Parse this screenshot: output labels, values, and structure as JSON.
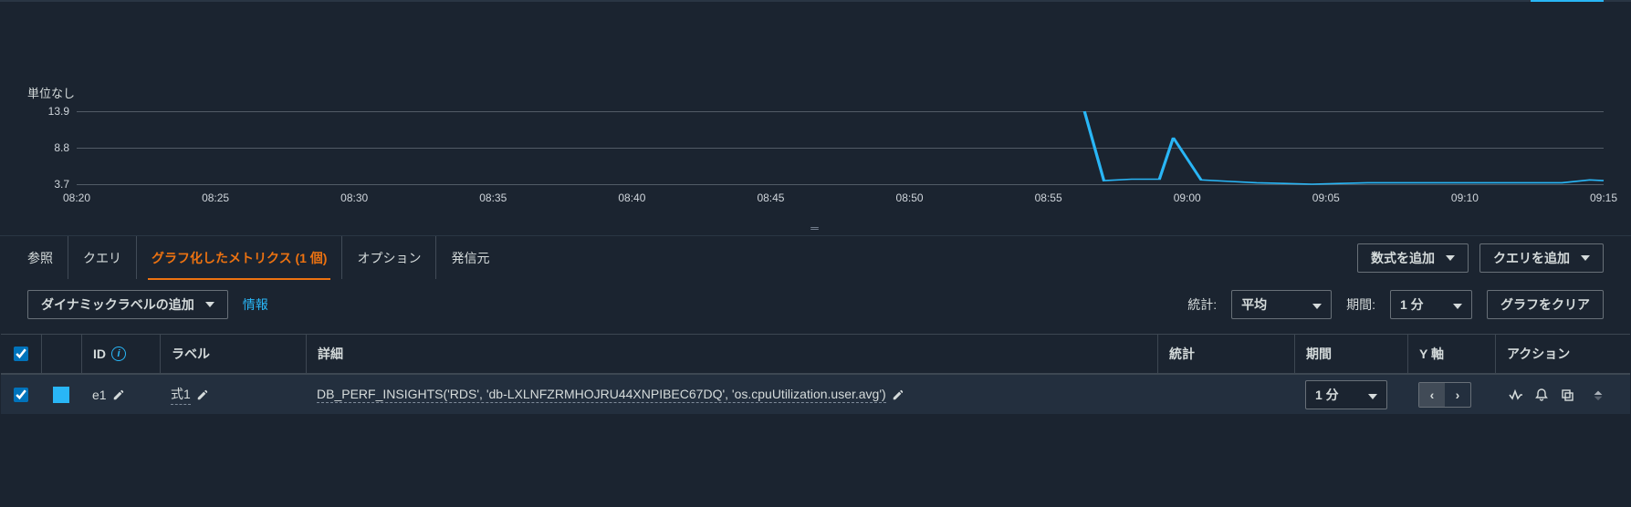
{
  "chart": {
    "unit_label": "単位なし",
    "y_ticks": [
      "13.9",
      "8.8",
      "3.7"
    ],
    "x_ticks": [
      "08:20",
      "08:25",
      "08:30",
      "08:35",
      "08:40",
      "08:45",
      "08:50",
      "08:55",
      "09:00",
      "09:05",
      "09:10",
      "09:15"
    ]
  },
  "chart_data": {
    "type": "line",
    "title": "",
    "xlabel": "",
    "ylabel": "単位なし",
    "ylim": [
      3.7,
      13.9
    ],
    "x": [
      "08:20",
      "08:25",
      "08:30",
      "08:35",
      "08:40",
      "08:45",
      "08:50",
      "08:55",
      "09:00",
      "09:05",
      "09:10",
      "09:15"
    ],
    "series": [
      {
        "name": "式1",
        "color": "#29b6f6",
        "points": [
          {
            "x": "08:56.3",
            "y": 13.9
          },
          {
            "x": "08:57.0",
            "y": 4.2
          },
          {
            "x": "08:58.0",
            "y": 4.4
          },
          {
            "x": "08:59.0",
            "y": 4.4
          },
          {
            "x": "08:59.5",
            "y": 10.2
          },
          {
            "x": "09:00.5",
            "y": 4.3
          },
          {
            "x": "09:01.5",
            "y": 4.1
          },
          {
            "x": "09:02.5",
            "y": 3.9
          },
          {
            "x": "09:03.5",
            "y": 3.8
          },
          {
            "x": "09:04.5",
            "y": 3.7
          },
          {
            "x": "09:05.5",
            "y": 3.8
          },
          {
            "x": "09:06.5",
            "y": 3.9
          },
          {
            "x": "09:07.5",
            "y": 3.9
          },
          {
            "x": "09:08.5",
            "y": 3.9
          },
          {
            "x": "09:09.5",
            "y": 3.9
          },
          {
            "x": "09:10.5",
            "y": 3.9
          },
          {
            "x": "09:11.5",
            "y": 3.9
          },
          {
            "x": "09:12.5",
            "y": 3.9
          },
          {
            "x": "09:13.5",
            "y": 3.9
          },
          {
            "x": "09:14.5",
            "y": 4.3
          },
          {
            "x": "09:15.0",
            "y": 4.2
          }
        ]
      }
    ]
  },
  "tabs": {
    "browse": "参照",
    "query": "クエリ",
    "graphed": "グラフ化したメトリクス (1 個)",
    "options": "オプション",
    "source": "発信元"
  },
  "buttons": {
    "add_math": "数式を追加",
    "add_query": "クエリを追加",
    "add_dynamic_label": "ダイナミックラベルの追加",
    "info": "情報",
    "clear_graph": "グラフをクリア"
  },
  "controls": {
    "stat_label": "統計:",
    "stat_value": "平均",
    "period_label": "期間:",
    "period_value": "1 分"
  },
  "table": {
    "headers": {
      "id": "ID",
      "label": "ラベル",
      "detail": "詳細",
      "stat": "統計",
      "period": "期間",
      "yaxis": "Y 軸",
      "action": "アクション"
    },
    "row": {
      "checked": true,
      "color": "#29b6f6",
      "id": "e1",
      "label": "式1",
      "detail": "DB_PERF_INSIGHTS('RDS', 'db-LXLNFZRMHOJRU44XNPIBEC67DQ', 'os.cpuUtilization.user.avg')",
      "stat": "",
      "period": "1 分",
      "yaxis": "left"
    }
  }
}
